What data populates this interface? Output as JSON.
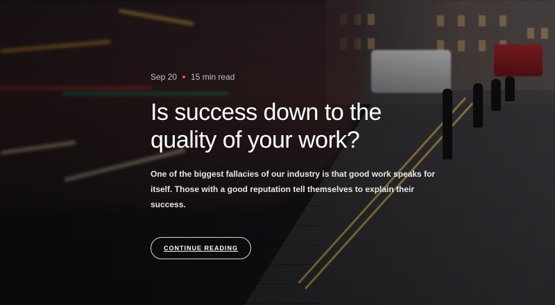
{
  "post": {
    "date": "Sep 20",
    "read_time": "15 min read",
    "title": "Is success down to the quality of your work?",
    "excerpt": "One of the biggest fallacies of our industry is that good work speaks for itself. Those with a good reputation tell themselves to explain their success.",
    "cta_label": "CONTINUE READING"
  },
  "colors": {
    "accent_dot": "#ff4d4d",
    "text": "#ffffff"
  }
}
